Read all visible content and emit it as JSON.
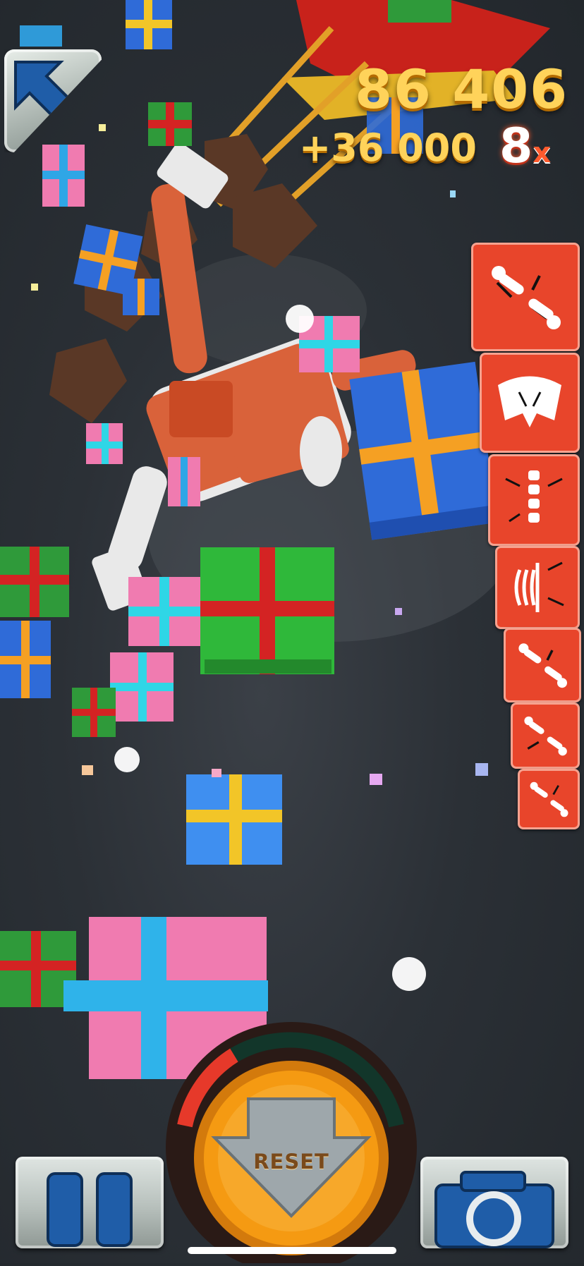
{
  "hud": {
    "score": "86 406",
    "bonus": "+36 000",
    "multiplier_value": "8",
    "multiplier_suffix": "x"
  },
  "controls": {
    "reset_label": "RESET"
  },
  "injury_icons": [
    "bone-break-icon",
    "pelvis-break-icon",
    "spine-break-icon",
    "ribcage-break-icon",
    "bone-break-icon",
    "bone-break-icon",
    "bone-break-icon"
  ],
  "icons": {
    "back": "back-arrow-icon",
    "pause": "pause-icon",
    "camera": "camera-icon"
  },
  "colors": {
    "score_gold": "#ffd35a",
    "injury_red": "#e8452b",
    "reset_orange": "#f59a12"
  }
}
